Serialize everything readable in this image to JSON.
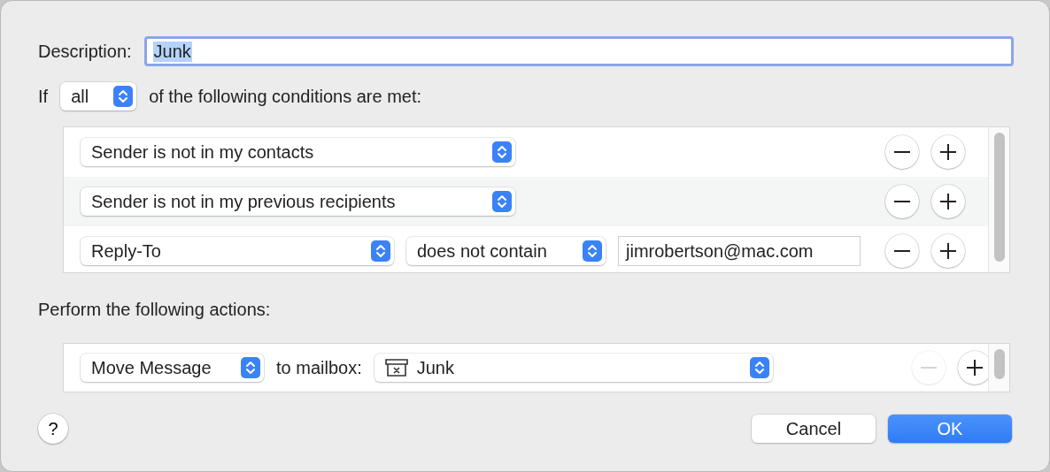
{
  "description": {
    "label": "Description:",
    "value": "Junk",
    "text_selected": true
  },
  "match": {
    "prefix": "If",
    "value": "all",
    "suffix": "of the following conditions are met:"
  },
  "conditions": [
    {
      "kind": "single",
      "field": "Sender is not in my contacts"
    },
    {
      "kind": "single",
      "field": "Sender is not in my previous recipients"
    },
    {
      "kind": "compare",
      "field": "Reply-To",
      "operator": "does not contain",
      "value": "jimrobertson@mac.com"
    }
  ],
  "actions_label": "Perform the following actions:",
  "actions": [
    {
      "action": "Move Message",
      "preposition": "to mailbox:",
      "mailbox": "Junk",
      "remove_disabled": true
    }
  ],
  "help": "?",
  "buttons": [
    {
      "label": "Cancel",
      "default": false
    },
    {
      "label": "OK",
      "default": true
    }
  ]
}
